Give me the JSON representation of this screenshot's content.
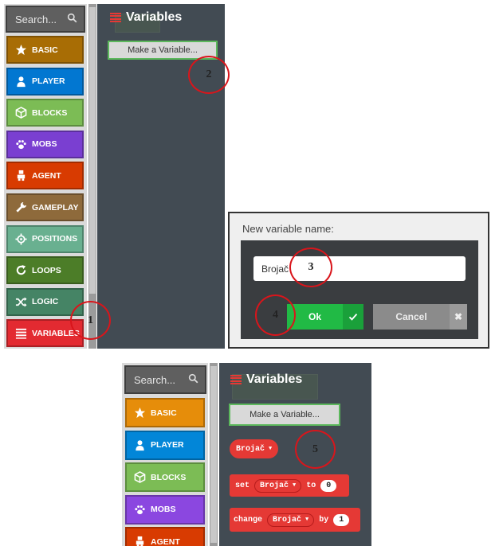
{
  "search": {
    "placeholder": "Search..."
  },
  "categories": [
    {
      "label": "BASIC",
      "icon": "star-icon",
      "color": "#a86d05"
    },
    {
      "label": "PLAYER",
      "icon": "person-icon",
      "color": "#0277d1"
    },
    {
      "label": "BLOCKS",
      "icon": "cube-icon",
      "color": "#7cbc55"
    },
    {
      "label": "MOBS",
      "icon": "paw-icon",
      "color": "#7a3fd1"
    },
    {
      "label": "AGENT",
      "icon": "agent-icon",
      "color": "#d83b01"
    },
    {
      "label": "GAMEPLAY",
      "icon": "wrench-icon",
      "color": "#8e6a3b"
    },
    {
      "label": "POSITIONS",
      "icon": "crosshair-icon",
      "color": "#69b090"
    },
    {
      "label": "LOOPS",
      "icon": "loop-arrow-icon",
      "color": "#4c7d28"
    },
    {
      "label": "LOGIC",
      "icon": "shuffle-icon",
      "color": "#458465"
    },
    {
      "label": "VARIABLES",
      "icon": "list-icon",
      "color": "#e32a31"
    }
  ],
  "bottom_categories": [
    {
      "label": "BASIC",
      "icon": "star-icon",
      "color": "#e68d0a"
    },
    {
      "label": "PLAYER",
      "icon": "person-icon",
      "color": "#0286d8"
    },
    {
      "label": "BLOCKS",
      "icon": "cube-icon",
      "color": "#7cbc55"
    },
    {
      "label": "MOBS",
      "icon": "paw-icon",
      "color": "#8b47e0"
    },
    {
      "label": "AGENT",
      "icon": "agent-icon",
      "color": "#d83b01"
    }
  ],
  "flyout": {
    "title": "Variables",
    "make_variable": "Make a Variable..."
  },
  "dialog": {
    "title": "New variable name:",
    "input_value": "Brojač",
    "ok": "Ok",
    "cancel": "Cancel"
  },
  "blocks": {
    "variable_name": "Brojač",
    "set_keyword": "set",
    "to_keyword": "to",
    "set_value": "0",
    "change_keyword": "change",
    "by_keyword": "by",
    "change_value": "1"
  },
  "markers": [
    "1",
    "2",
    "3",
    "4",
    "5"
  ],
  "colors": {
    "marker": "#d9151b",
    "variables": "#e53935",
    "ok_green": "#21ba45"
  }
}
